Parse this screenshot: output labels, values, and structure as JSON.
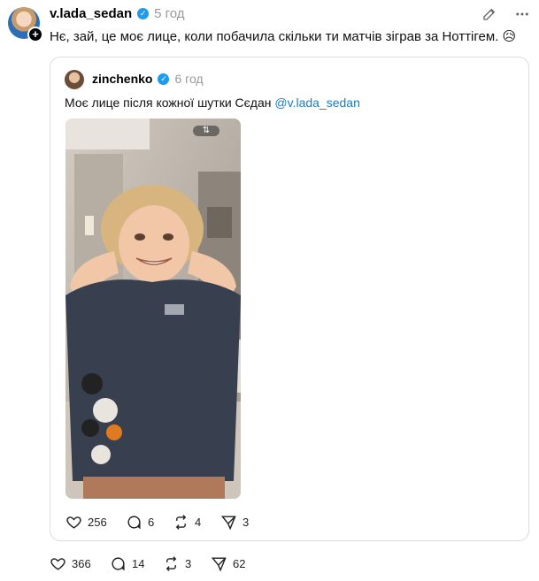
{
  "post": {
    "username": "v.lada_sedan",
    "time": "5 год",
    "text": "Нє, зай, це моє лице, коли побачила скільки ти матчів зіграв за Ноттігем.",
    "emoji": "😥",
    "stats": {
      "likes": "366",
      "comments": "14",
      "reposts": "3",
      "shares": "62"
    }
  },
  "quote": {
    "username": "zinchenko",
    "time": "6 год",
    "text": "Моє лице після кожної шутки Сєдан",
    "mention": "@v.lada_sedan",
    "stats": {
      "likes": "256",
      "comments": "6",
      "reposts": "4",
      "shares": "3"
    }
  },
  "icons": {
    "edit": "pencil-icon",
    "more": "more-icon",
    "like": "heart-icon",
    "comment": "comment-icon",
    "repost": "repost-icon",
    "share": "share-icon",
    "verified": "verified-icon"
  },
  "colors": {
    "verified": "#1d9bf0",
    "mention": "#1c7bc4",
    "muted": "#999999",
    "border": "#dcdcdc"
  }
}
